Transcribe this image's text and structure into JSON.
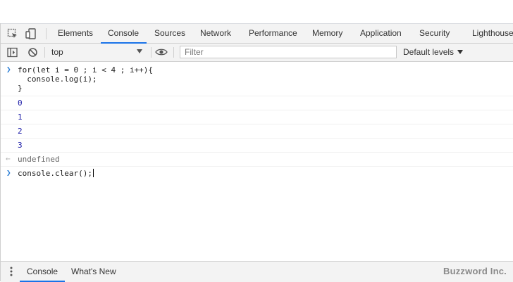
{
  "tabs": [
    "Elements",
    "Console",
    "Sources",
    "Network",
    "Performance",
    "Memory",
    "Application",
    "Security",
    "Lighthouse"
  ],
  "active_tab": "Console",
  "toolbar": {
    "context": "top",
    "filter_placeholder": "Filter",
    "levels": "Default levels"
  },
  "console": {
    "input1_line1": "for(let i = 0 ; i < 4 ; i++){",
    "input1_line2": "  console.log(i);",
    "input1_line3": "}",
    "outputs": [
      "0",
      "1",
      "2",
      "3"
    ],
    "return_value": "undefined",
    "input2": "console.clear();"
  },
  "drawer": {
    "tabs": [
      "Console",
      "What's New"
    ],
    "brand": "Buzzword Inc."
  },
  "colors": {
    "accent": "#1a73e8",
    "prompt": "#2b7ed6",
    "number_output": "#1a1aa6"
  }
}
